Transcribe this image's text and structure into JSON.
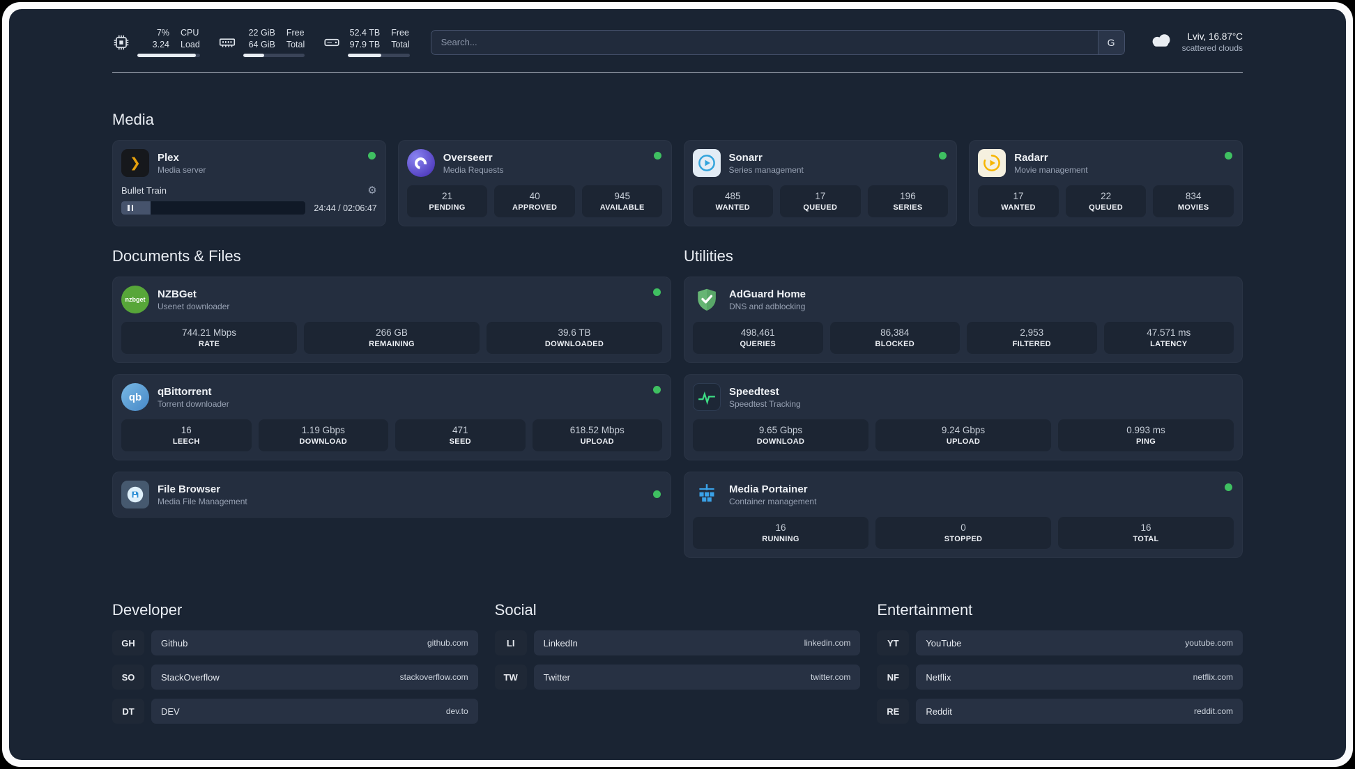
{
  "colors": {
    "background": "#1a2433",
    "card": "#242e3f",
    "tile": "#1c2533",
    "status_green": "#3fc061",
    "plex_gold": "#e5a00d",
    "sonarr_blue": "#33a4dc",
    "radarr_gold": "#f7b500",
    "adguard_green": "#66b574",
    "portainer_blue": "#3aa2e8",
    "speedtest_green": "#3ddc84"
  },
  "glyphs": {
    "gear": "⚙",
    "plex_chevron": "❯"
  },
  "topbar": {
    "cpu": {
      "line1": "7%",
      "line2": "3.24",
      "label1": "CPU",
      "label2": "Load",
      "fill_percent": 93
    },
    "ram": {
      "line1": "22 GiB",
      "line2": "64 GiB",
      "label1": "Free",
      "label2": "Total",
      "fill_percent": 34
    },
    "disk": {
      "line1": "52.4 TB",
      "line2": "97.9 TB",
      "label1": "Free",
      "label2": "Total",
      "fill_percent": 54
    },
    "search": {
      "placeholder": "Search...",
      "engine_label": "G"
    },
    "weather": {
      "location": "Lviv, 16.87°C",
      "condition": "scattered clouds"
    }
  },
  "sections": {
    "media": "Media",
    "documents": "Documents & Files",
    "utilities": "Utilities",
    "developer": "Developer",
    "social": "Social",
    "entertainment": "Entertainment"
  },
  "apps": {
    "plex": {
      "name": "Plex",
      "subtitle": "Media server",
      "now_playing": "Bullet Train",
      "progress_percent": 16,
      "time": "24:44 / 02:06:47"
    },
    "overseerr": {
      "name": "Overseerr",
      "subtitle": "Media Requests",
      "stats": [
        {
          "value": "21",
          "label": "PENDING"
        },
        {
          "value": "40",
          "label": "APPROVED"
        },
        {
          "value": "945",
          "label": "AVAILABLE"
        }
      ]
    },
    "sonarr": {
      "name": "Sonarr",
      "subtitle": "Series management",
      "stats": [
        {
          "value": "485",
          "label": "WANTED"
        },
        {
          "value": "17",
          "label": "QUEUED"
        },
        {
          "value": "196",
          "label": "SERIES"
        }
      ]
    },
    "radarr": {
      "name": "Radarr",
      "subtitle": "Movie management",
      "stats": [
        {
          "value": "17",
          "label": "WANTED"
        },
        {
          "value": "22",
          "label": "QUEUED"
        },
        {
          "value": "834",
          "label": "MOVIES"
        }
      ]
    },
    "nzbget": {
      "name": "NZBGet",
      "subtitle": "Usenet downloader",
      "icon_text": "nzbget",
      "stats": [
        {
          "value": "744.21 Mbps",
          "label": "RATE"
        },
        {
          "value": "266 GB",
          "label": "REMAINING"
        },
        {
          "value": "39.6 TB",
          "label": "DOWNLOADED"
        }
      ]
    },
    "qbittorrent": {
      "name": "qBittorrent",
      "subtitle": "Torrent downloader",
      "icon_text": "qb",
      "stats": [
        {
          "value": "16",
          "label": "LEECH"
        },
        {
          "value": "1.19 Gbps",
          "label": "DOWNLOAD"
        },
        {
          "value": "471",
          "label": "SEED"
        },
        {
          "value": "618.52 Mbps",
          "label": "UPLOAD"
        }
      ]
    },
    "filebrowser": {
      "name": "File Browser",
      "subtitle": "Media File Management"
    },
    "adguard": {
      "name": "AdGuard Home",
      "subtitle": "DNS and adblocking",
      "stats": [
        {
          "value": "498,461",
          "label": "QUERIES"
        },
        {
          "value": "86,384",
          "label": "BLOCKED"
        },
        {
          "value": "2,953",
          "label": "FILTERED"
        },
        {
          "value": "47.571 ms",
          "label": "LATENCY"
        }
      ]
    },
    "speedtest": {
      "name": "Speedtest",
      "subtitle": "Speedtest Tracking",
      "stats": [
        {
          "value": "9.65 Gbps",
          "label": "DOWNLOAD"
        },
        {
          "value": "9.24 Gbps",
          "label": "UPLOAD"
        },
        {
          "value": "0.993 ms",
          "label": "PING"
        }
      ]
    },
    "portainer": {
      "name": "Media Portainer",
      "subtitle": "Container management",
      "stats": [
        {
          "value": "16",
          "label": "RUNNING"
        },
        {
          "value": "0",
          "label": "STOPPED"
        },
        {
          "value": "16",
          "label": "TOTAL"
        }
      ]
    }
  },
  "bookmarks": {
    "developer": [
      {
        "abbr": "GH",
        "name": "Github",
        "url": "github.com"
      },
      {
        "abbr": "SO",
        "name": "StackOverflow",
        "url": "stackoverflow.com"
      },
      {
        "abbr": "DT",
        "name": "DEV",
        "url": "dev.to"
      }
    ],
    "social": [
      {
        "abbr": "LI",
        "name": "LinkedIn",
        "url": "linkedin.com"
      },
      {
        "abbr": "TW",
        "name": "Twitter",
        "url": "twitter.com"
      }
    ],
    "entertainment": [
      {
        "abbr": "YT",
        "name": "YouTube",
        "url": "youtube.com"
      },
      {
        "abbr": "NF",
        "name": "Netflix",
        "url": "netflix.com"
      },
      {
        "abbr": "RE",
        "name": "Reddit",
        "url": "reddit.com"
      }
    ]
  }
}
